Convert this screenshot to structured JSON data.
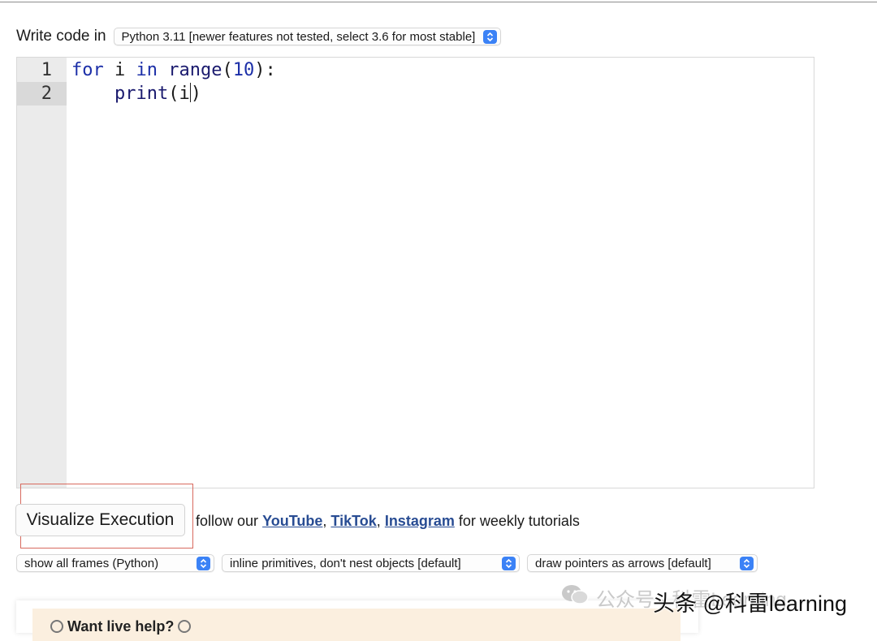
{
  "header": {
    "write_label": "Write code in",
    "language_select": "Python 3.11 [newer features not tested, select 3.6 for most stable]"
  },
  "editor": {
    "line_numbers": [
      "1",
      "2"
    ],
    "lines": [
      {
        "tokens": [
          {
            "text": "for",
            "cls": "kw"
          },
          {
            "text": " i ",
            "cls": ""
          },
          {
            "text": "in",
            "cls": "kw"
          },
          {
            "text": " ",
            "cls": ""
          },
          {
            "text": "range",
            "cls": "fn"
          },
          {
            "text": "(",
            "cls": ""
          },
          {
            "text": "10",
            "cls": "num"
          },
          {
            "text": "):",
            "cls": ""
          }
        ]
      },
      {
        "tokens": [
          {
            "text": "    ",
            "cls": ""
          },
          {
            "text": "print",
            "cls": "fn"
          },
          {
            "text": "(i",
            "cls": ""
          },
          {
            "text": "",
            "cls": "cursor"
          },
          {
            "text": ")",
            "cls": ""
          }
        ]
      }
    ],
    "active_line": 2
  },
  "actions": {
    "visualize_label": "Visualize Execution",
    "follow_prefix": "follow our",
    "youtube": "YouTube",
    "sep1": ",",
    "tiktok": "TikTok",
    "sep2": ",",
    "instagram": "Instagram",
    "follow_suffix": "for weekly tutorials"
  },
  "options": {
    "frames": "show all frames (Python)",
    "primitives": "inline primitives, don't nest objects [default]",
    "pointers": "draw pointers as arrows [default]"
  },
  "panel": {
    "text": "Want live help?"
  },
  "watermark": {
    "faded": "公众号 · 科雷Learning",
    "overlay": "头条 @科雷learning"
  },
  "colors": {
    "accent": "#3b82f6",
    "link": "#284c93",
    "highlight_box": "#d86a5e",
    "panel_bg": "#fbefdf"
  },
  "icons": {
    "select_chevron": "chevron-up-down-icon",
    "wechat": "wechat-icon",
    "clock": "alarm-clock-icon"
  }
}
